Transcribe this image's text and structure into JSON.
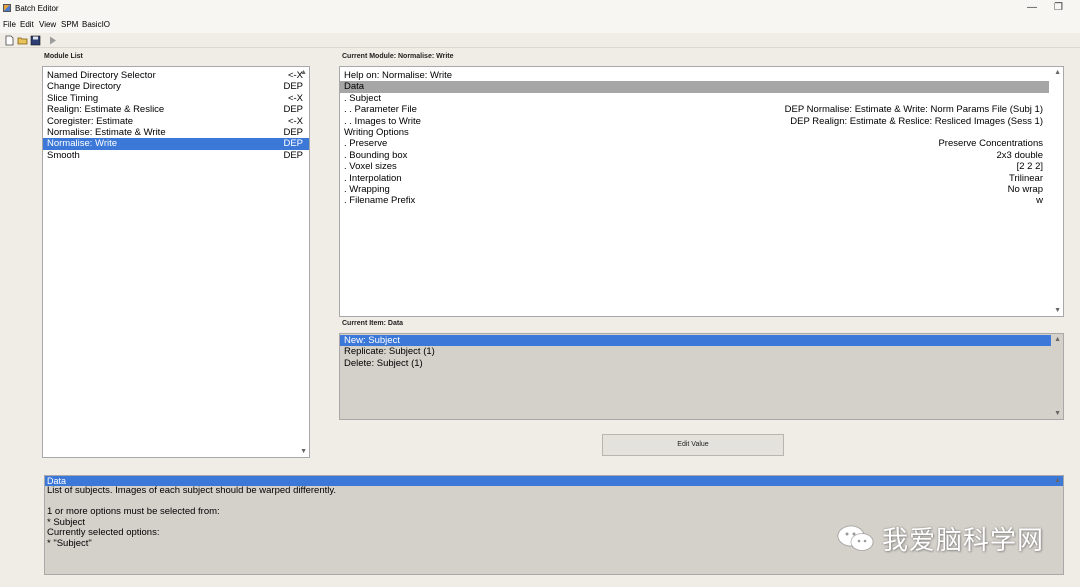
{
  "window": {
    "title": "Batch Editor",
    "minimize": "—",
    "restore": "❐"
  },
  "menu": [
    "File",
    "Edit",
    "View",
    "SPM",
    "BasicIO"
  ],
  "toolbar": {
    "icons": [
      "new-file-icon",
      "open-folder-icon",
      "save-icon",
      "run-icon"
    ]
  },
  "module_list": {
    "label": "Module List",
    "items": [
      {
        "name": "Named Directory Selector",
        "tag": "<-X"
      },
      {
        "name": "Change Directory",
        "tag": "DEP"
      },
      {
        "name": "Slice Timing",
        "tag": "<-X"
      },
      {
        "name": "Realign: Estimate & Reslice",
        "tag": "DEP"
      },
      {
        "name": "Coregister: Estimate",
        "tag": "<-X"
      },
      {
        "name": "Normalise: Estimate & Write",
        "tag": "DEP"
      },
      {
        "name": "Normalise: Write",
        "tag": "DEP"
      },
      {
        "name": "Smooth",
        "tag": "DEP"
      }
    ]
  },
  "current_module": {
    "label": "Current Module: Normalise: Write",
    "items": [
      {
        "name": "Help on: Normalise: Write",
        "value": ""
      },
      {
        "name": "Data",
        "value": ""
      },
      {
        "name": ". Subject",
        "value": ""
      },
      {
        "name": ". . Parameter File",
        "value": "DEP Normalise: Estimate & Write: Norm Params File (Subj 1)"
      },
      {
        "name": ". . Images to Write",
        "value": "DEP Realign: Estimate & Reslice: Resliced Images (Sess 1)"
      },
      {
        "name": "Writing Options",
        "value": ""
      },
      {
        "name": ". Preserve",
        "value": "Preserve Concentrations"
      },
      {
        "name": ". Bounding box",
        "value": "2x3 double"
      },
      {
        "name": ". Voxel sizes",
        "value": "[2 2 2]"
      },
      {
        "name": ". Interpolation",
        "value": "Trilinear"
      },
      {
        "name": ". Wrapping",
        "value": "No wrap"
      },
      {
        "name": ". Filename Prefix",
        "value": "w"
      }
    ]
  },
  "current_item": {
    "label": "Current Item: Data",
    "items": [
      "New: Subject",
      "Replicate: Subject (1)",
      "Delete: Subject (1)"
    ]
  },
  "edit_button": "Edit Value",
  "help": {
    "title": "Data",
    "lines": [
      "List of subjects. Images of each subject should be warped differently.",
      "",
      "1 or more options must be selected from:",
      "* Subject",
      "Currently selected options:",
      "* \"Subject\""
    ]
  },
  "watermark": {
    "text": "我爱脑科学网"
  },
  "colors": {
    "selection": "#3c78d8",
    "highlight": "#a6a6a6",
    "background": "#f0ede6"
  }
}
